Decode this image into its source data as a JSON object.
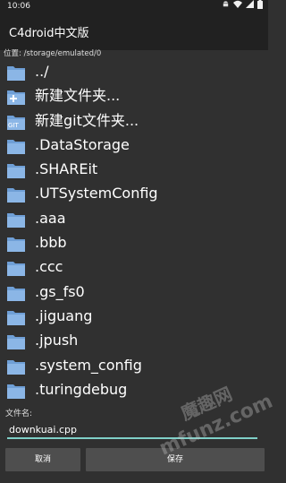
{
  "status_bar": {
    "time": "10:06",
    "icons": [
      "android-icon",
      "wifi-icon",
      "signal-icon",
      "battery-icon"
    ]
  },
  "app_bar": {
    "title": "C4droid中文版"
  },
  "location": {
    "text": "位置: /storage/emulated/0"
  },
  "files": [
    {
      "name": "../",
      "icon": "folder-icon"
    },
    {
      "name": "新建文件夹...",
      "icon": "new-folder-icon"
    },
    {
      "name": "新建git文件夹...",
      "icon": "git-folder-icon"
    },
    {
      "name": ".DataStorage",
      "icon": "folder-icon"
    },
    {
      "name": ".SHAREit",
      "icon": "folder-icon"
    },
    {
      "name": ".UTSystemConfig",
      "icon": "folder-icon"
    },
    {
      "name": ".aaa",
      "icon": "folder-icon"
    },
    {
      "name": ".bbb",
      "icon": "folder-icon"
    },
    {
      "name": ".ccc",
      "icon": "folder-icon"
    },
    {
      "name": ".gs_fs0",
      "icon": "folder-icon"
    },
    {
      "name": ".jiguang",
      "icon": "folder-icon"
    },
    {
      "name": ".jpush",
      "icon": "folder-icon"
    },
    {
      "name": ".system_config",
      "icon": "folder-icon"
    },
    {
      "name": ".turingdebug",
      "icon": "folder-icon"
    }
  ],
  "filename": {
    "label": "文件名:",
    "value": "downkuai.cpp"
  },
  "buttons": {
    "cancel": "取消",
    "save": "保存"
  },
  "watermark": {
    "text": "mfunz.com",
    "cn": "魔趣网"
  },
  "colors": {
    "background": "#303030",
    "bar": "#212121",
    "folder": "#6f9fd6",
    "accent": "#7fcfc7",
    "button": "#4e4e4e"
  }
}
